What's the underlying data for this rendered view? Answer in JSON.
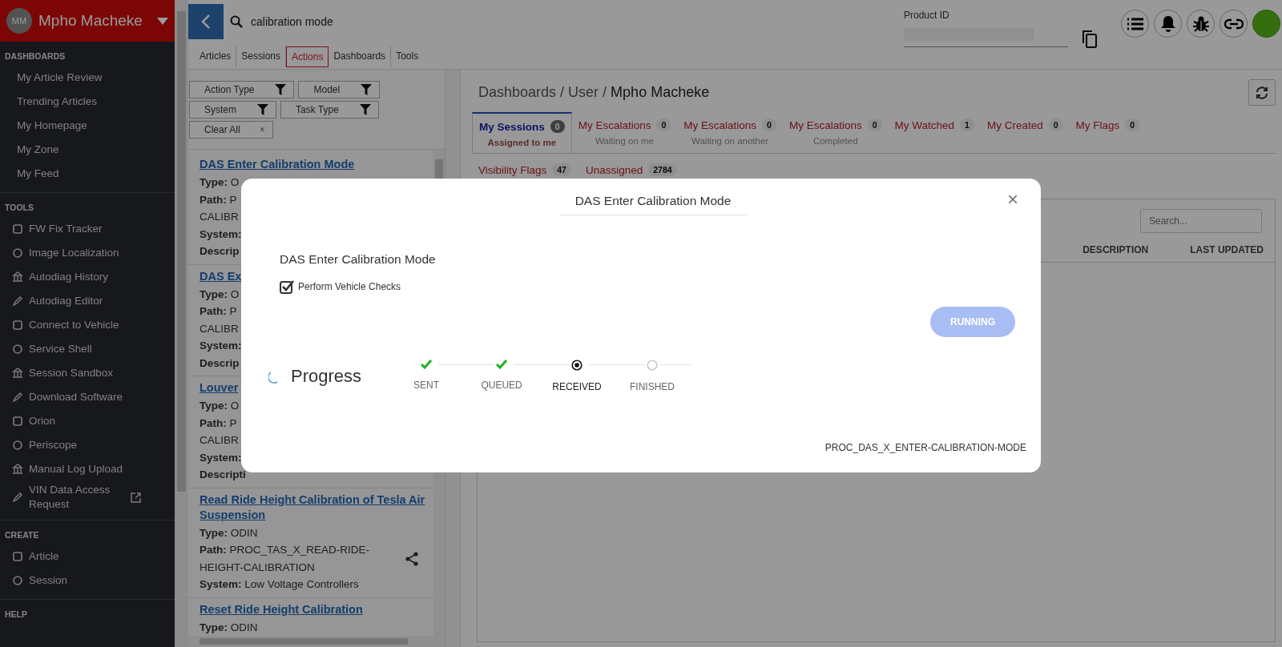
{
  "user": {
    "initials": "MM",
    "name": "Mpho Macheke"
  },
  "sidebar": {
    "sections": [
      {
        "title": "DASHBOARDS",
        "items": [
          {
            "label": "My Article Review"
          },
          {
            "label": "Trending Articles"
          },
          {
            "label": "My Homepage"
          },
          {
            "label": "My Zone"
          },
          {
            "label": "My Feed"
          }
        ]
      },
      {
        "title": "TOOLS",
        "items": [
          {
            "label": "FW Fix Tracker",
            "external": false
          },
          {
            "label": "Image Localization",
            "external": false
          },
          {
            "label": "Autodiag History",
            "external": false
          },
          {
            "label": "Autodiag Editor",
            "external": false
          },
          {
            "label": "Connect to Vehicle",
            "external": false
          },
          {
            "label": "Service Shell",
            "external": false
          },
          {
            "label": "Session Sandbox",
            "external": false
          },
          {
            "label": "Download Software",
            "external": false
          },
          {
            "label": "Orion",
            "external": false
          },
          {
            "label": "Periscope",
            "external": false
          },
          {
            "label": "Manual Log Upload",
            "external": false
          },
          {
            "label": "VIN Data Access Request",
            "external": true
          }
        ]
      },
      {
        "title": "CREATE",
        "items": [
          {
            "label": "Article",
            "external": false
          },
          {
            "label": "Session",
            "external": false
          }
        ]
      },
      {
        "title": "HELP"
      }
    ]
  },
  "search": {
    "value": "calibration mode"
  },
  "nav_tabs": [
    {
      "label": "Articles",
      "selected": false
    },
    {
      "label": "Sessions",
      "selected": false
    },
    {
      "label": "Actions",
      "selected": true
    },
    {
      "label": "Dashboards",
      "selected": false
    },
    {
      "label": "Tools",
      "selected": false
    }
  ],
  "product_id": {
    "label": "Product ID"
  },
  "filters": [
    {
      "label": "Action Type"
    },
    {
      "label": "Model"
    },
    {
      "label": "System"
    },
    {
      "label": "Task Type"
    }
  ],
  "clear_filters": {
    "label": "Clear All",
    "close": "×"
  },
  "results": [
    {
      "title": "DAS Enter Calibration Mode",
      "lines": [
        "**Type:** O",
        "**Path:** P",
        "CALIBR",
        "**System:**",
        "**Descrip**"
      ]
    },
    {
      "title": "DAS Ex",
      "lines": [
        "**Type:** O",
        "**Path:** P",
        "CALIBR",
        "**System:**",
        "**Descrip**"
      ]
    },
    {
      "title": "Louver",
      "lines": [
        "**Type:** O",
        "**Path:** P",
        "CALIBR",
        "**System:**",
        "**Descripti**"
      ]
    },
    {
      "title": "Read Ride Height Calibration of Tesla Air Suspension",
      "lines": [
        "**Type:** ODIN",
        "**Path:** PROC_TAS_X_READ-RIDE-",
        "HEIGHT-CALIBRATION",
        "**System:** Low Voltage Controllers"
      ],
      "share": true
    },
    {
      "title": "Reset Ride Height Calibration",
      "lines": [
        "**Type:** ODIN"
      ]
    }
  ],
  "breadcrumb": {
    "parts": [
      "Dashboards",
      "User",
      "Mpho Macheke"
    ],
    "separator": "/"
  },
  "dashboard_tabs": [
    {
      "label": "My Sessions",
      "count": "0",
      "sublabel": "Assigned to me",
      "selected": true
    },
    {
      "label": "My Escalations",
      "count": "0",
      "sublabel": "Waiting on me",
      "selected": false
    },
    {
      "label": "My Escalations",
      "count": "0",
      "sublabel": "Waiting on another",
      "selected": false
    },
    {
      "label": "My Escalations",
      "count": "0",
      "sublabel": "Completed",
      "selected": false
    },
    {
      "label": "My Watched",
      "count": "1",
      "selected": false
    },
    {
      "label": "My Created",
      "count": "0",
      "selected": false
    },
    {
      "label": "My Flags",
      "count": "0",
      "selected": false
    }
  ],
  "secondary_tabs": [
    {
      "label": "Visibility Flags",
      "count": "47"
    },
    {
      "label": "Unassigned",
      "count": "2784"
    }
  ],
  "table": {
    "search_placeholder": "Search...",
    "columns": [
      "DESCRIPTION",
      "LAST UPDATED"
    ]
  },
  "modal": {
    "title": "DAS Enter Calibration Mode",
    "close": "×",
    "heading": "DAS Enter Calibration Mode",
    "checkbox": {
      "label": "Perform Vehicle Checks",
      "checked": true
    },
    "button": {
      "label": "RUNNING",
      "disabled": true
    },
    "progress_label": "Progress",
    "steps": [
      {
        "label": "SENT",
        "done": true,
        "current": false
      },
      {
        "label": "QUEUED",
        "done": true,
        "current": false
      },
      {
        "label": "RECEIVED",
        "done": false,
        "current": true
      },
      {
        "label": "FINISHED",
        "done": false,
        "current": false
      }
    ],
    "footer": "PROC_DAS_X_ENTER-CALIBRATION-MODE"
  }
}
